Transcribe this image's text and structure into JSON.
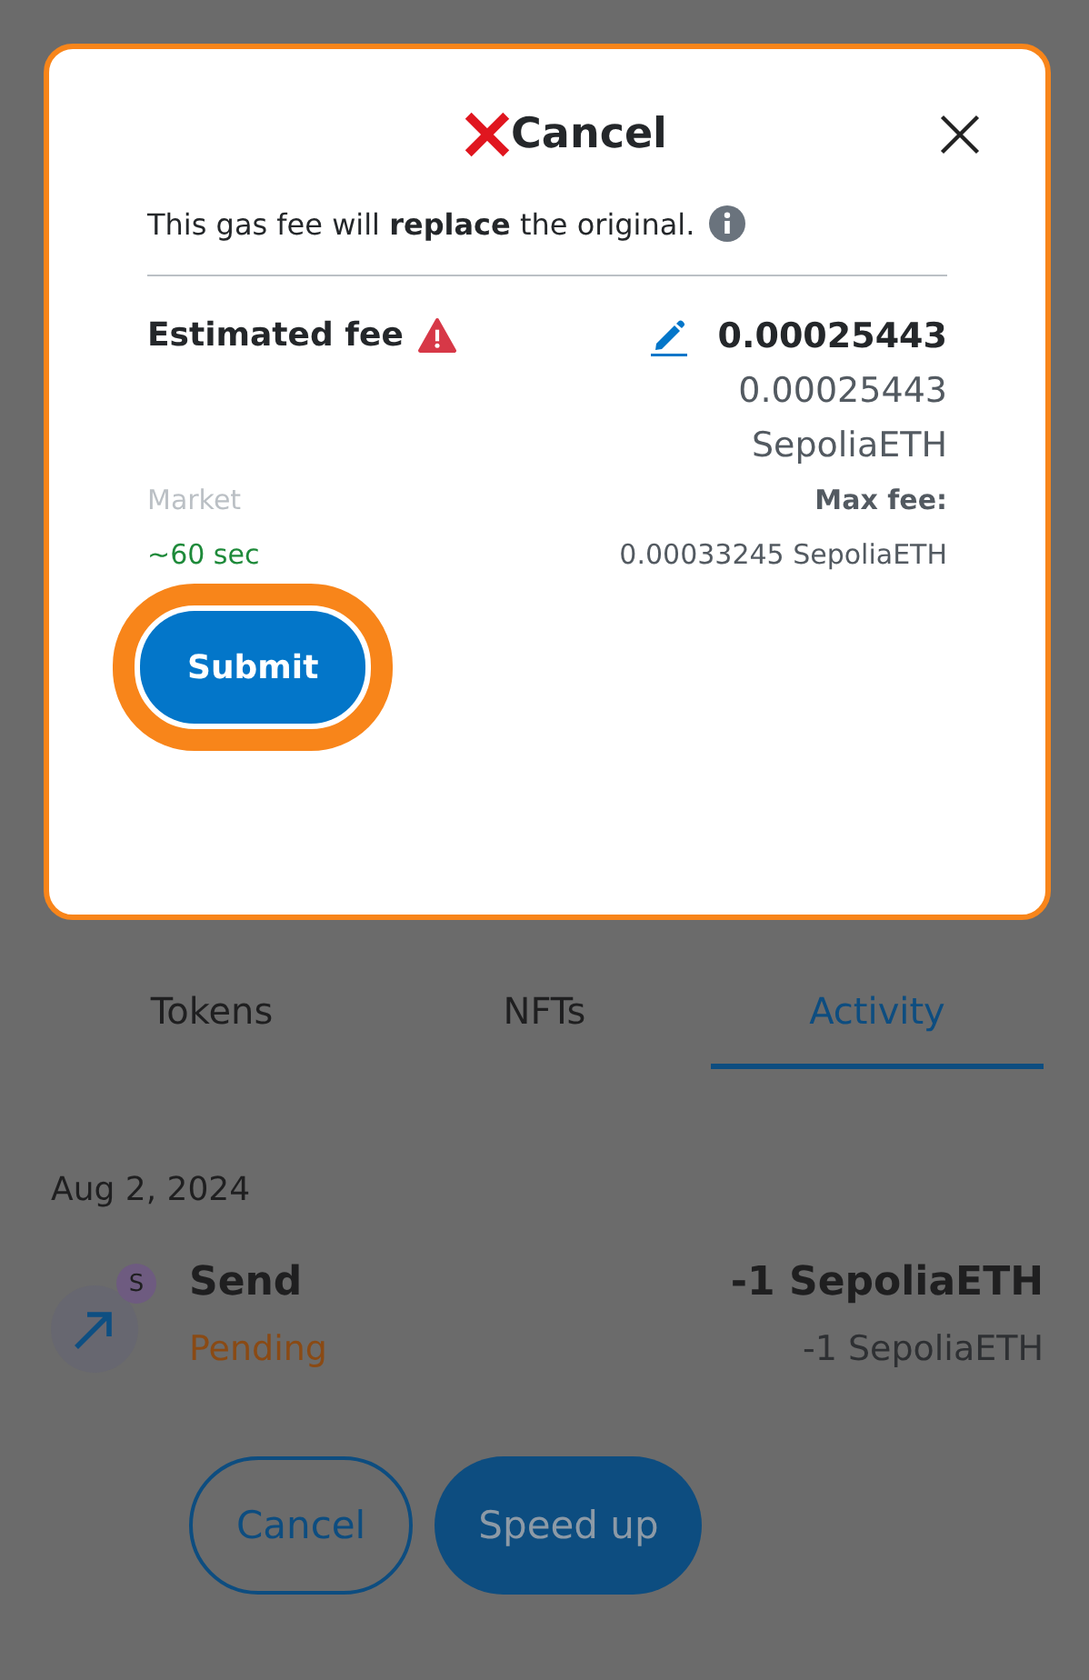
{
  "modal": {
    "title": "Cancel",
    "notice": "This gas fee will **replace** the original.",
    "fee_label": "Estimated fee",
    "fee_primary": "0.00025443",
    "fee_secondary": "0.00025443",
    "fee_currency": "SepoliaETH",
    "speed_label": "Market",
    "max_fee_label": "Max fee:",
    "time_estimate": "~60 sec",
    "max_fee_value": "0.00033245 SepoliaETH",
    "submit": "Submit",
    "highlighted": true
  },
  "tabs": [
    {
      "label": "Tokens",
      "selected": false
    },
    {
      "label": "NFTs",
      "selected": false
    },
    {
      "label": "Activity",
      "selected": true
    }
  ],
  "date": "Aug 2, 2024",
  "transaction": {
    "title": "Send",
    "status": "Pending",
    "network_badge": "S",
    "amount": "-1 SepoliaETH",
    "amount_secondary": "-1 SepoliaETH"
  },
  "actions": [
    {
      "label": "Cancel",
      "kind": "outline"
    },
    {
      "label": "Speed up",
      "kind": "filled"
    }
  ]
}
